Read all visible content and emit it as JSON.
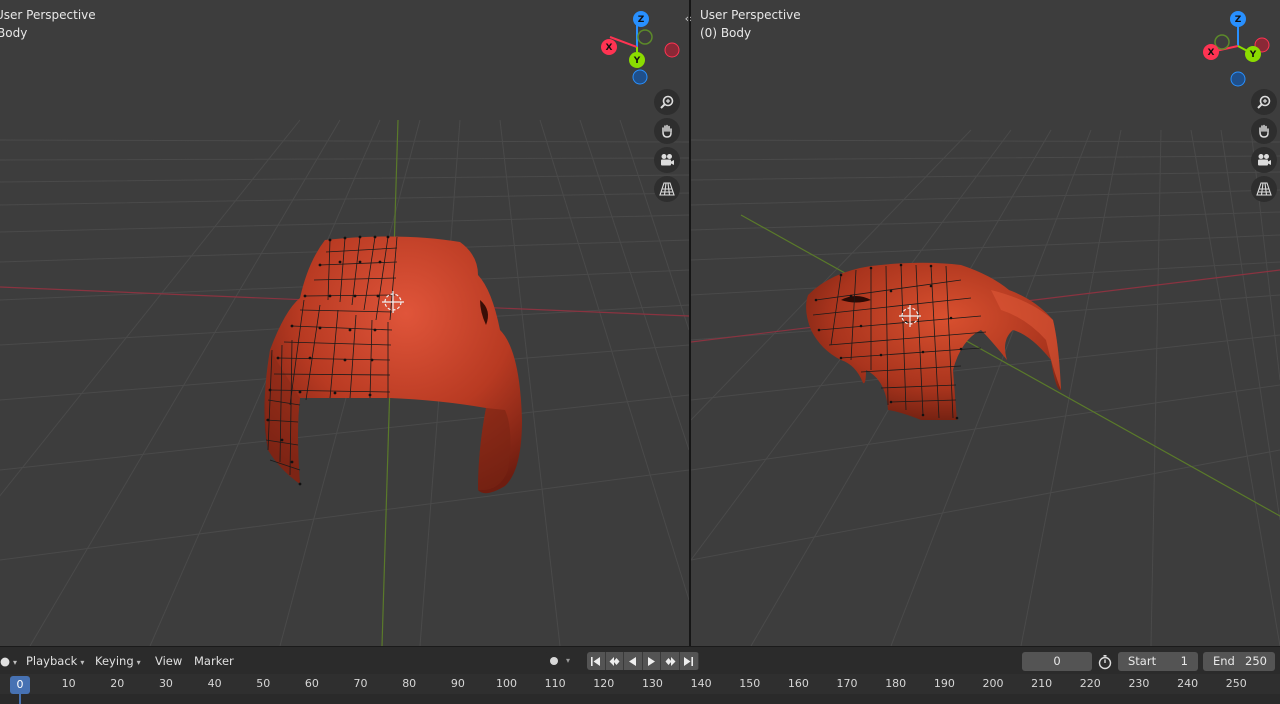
{
  "viewport_left": {
    "title": "User Perspective",
    "object": "Body"
  },
  "viewport_right": {
    "title": "User Perspective",
    "object": "(0) Body"
  },
  "gizmo_labels": {
    "x": "X",
    "y": "Y",
    "z": "Z"
  },
  "nav_icons": [
    "zoom-icon",
    "pan-hand-icon",
    "camera-view-icon",
    "perspective-grid-icon"
  ],
  "timeline": {
    "menus": {
      "playback": "Playback",
      "keying": "Keying",
      "view": "View",
      "marker": "Marker"
    },
    "current_frame": "0",
    "start_label": "Start",
    "start_value": "1",
    "end_label": "End",
    "end_value": "250",
    "playhead": "0",
    "ticks": [
      "10",
      "20",
      "30",
      "40",
      "50",
      "60",
      "70",
      "80",
      "90",
      "100",
      "110",
      "120",
      "130",
      "140",
      "150",
      "160",
      "170",
      "180",
      "190",
      "200",
      "210",
      "220",
      "230",
      "240",
      "250"
    ]
  },
  "colors": {
    "background": "#3d3d3d",
    "axis_x": "#ff3352",
    "axis_y": "#8bdc00",
    "axis_z": "#2890ff",
    "car_body": "#c9432a",
    "playhead": "#4772b3"
  }
}
